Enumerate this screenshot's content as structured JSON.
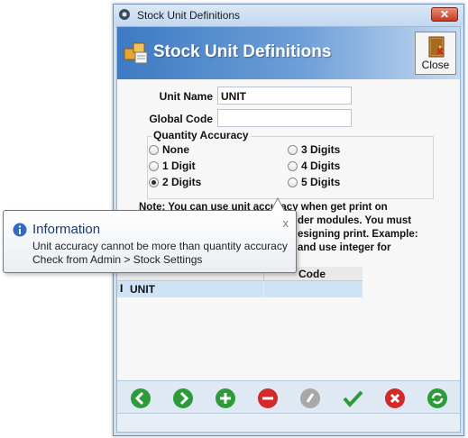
{
  "window": {
    "title": "Stock Unit Definitions",
    "close_glyph": "✕"
  },
  "banner": {
    "title": "Stock Unit Definitions",
    "icon": "boxes-icon",
    "close_label": "Close"
  },
  "form": {
    "unit_name_label": "Unit Name",
    "unit_name_value": "UNIT",
    "global_code_label": "Global Code",
    "global_code_value": "",
    "quantity_accuracy": {
      "title": "Quantity Accuracy",
      "options": [
        "None",
        "1 Digit",
        "2 Digits",
        "3 Digits",
        "4 Digits",
        "5 Digits"
      ],
      "selected": "2 Digits"
    },
    "note_lines": [
      "Note: You can use unit accuracy when get print on",
      "der modules. You must",
      "esigning print. Example:",
      "and use integer for"
    ]
  },
  "grid": {
    "columns": [
      "Code"
    ],
    "rows": [
      {
        "name": "UNIT",
        "code": ""
      }
    ],
    "row_cursor": "I"
  },
  "toolbar": {
    "buttons": [
      "first-icon",
      "next-icon",
      "add-icon",
      "delete-icon",
      "edit-icon",
      "save-icon",
      "cancel-icon",
      "refresh-icon"
    ],
    "colors": {
      "green": "#2e9b3a",
      "red": "#d22a2a",
      "gray": "#a8a8a8"
    }
  },
  "tooltip": {
    "title": "Information",
    "close_glyph": "x",
    "line1": "Unit accuracy cannot be more than quantity accuracy",
    "line2": "Check from Admin > Stock Settings"
  }
}
